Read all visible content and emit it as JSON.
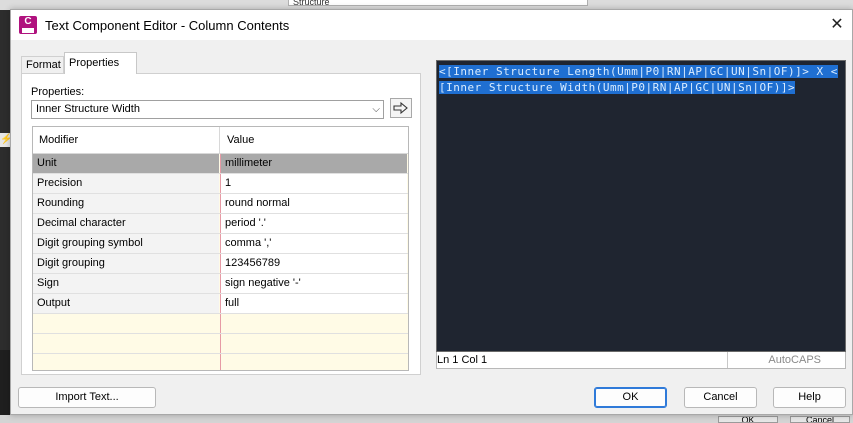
{
  "background": {
    "top_field_text": "Structure",
    "bottom_ok": "OK",
    "bottom_cancel": "Cancel"
  },
  "window": {
    "title": "Text Component Editor - Column Contents",
    "icon_letter": "C",
    "close_glyph": "✕"
  },
  "tabs": [
    {
      "label": "Format",
      "active": false
    },
    {
      "label": "Properties",
      "active": true
    }
  ],
  "properties": {
    "label": "Properties:",
    "selected": "Inner Structure Width",
    "chevron": "⌵"
  },
  "grid": {
    "headers": {
      "modifier": "Modifier",
      "value": "Value"
    },
    "rows": [
      {
        "modifier": "Unit",
        "value": "millimeter",
        "selected": true
      },
      {
        "modifier": "Precision",
        "value": "1"
      },
      {
        "modifier": "Rounding",
        "value": "round normal"
      },
      {
        "modifier": "Decimal character",
        "value": "period '.'"
      },
      {
        "modifier": "Digit grouping symbol",
        "value": "comma ','"
      },
      {
        "modifier": "Digit grouping",
        "value": "123456789"
      },
      {
        "modifier": "Sign",
        "value": "sign negative '-'"
      },
      {
        "modifier": "Output",
        "value": "full"
      }
    ]
  },
  "editor": {
    "text": "<[Inner Structure Length(Umm|P0|RN|AP|GC|UN|Sn|OF)]> X  <[Inner Structure Width(Umm|P0|RN|AP|GC|UN|Sn|OF)]>"
  },
  "status": {
    "position": "Ln 1 Col 1",
    "caps": "AutoCAPS"
  },
  "buttons": {
    "import": "Import Text...",
    "ok": "OK",
    "cancel": "Cancel",
    "help": "Help"
  },
  "colors": {
    "accent": "#2f7ad9",
    "selection": "#1f6fd1",
    "editor_bg": "#1f2530",
    "app_icon": "#b0127e"
  }
}
